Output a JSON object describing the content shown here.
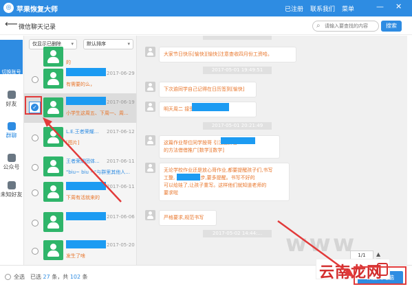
{
  "app": {
    "title": "苹果恢复大师"
  },
  "titlebar": {
    "registered": "已注册",
    "contact": "联系我们",
    "menu": "菜单",
    "minimize": "—",
    "close": "✕"
  },
  "subbar": {
    "back_glyph": "⟵",
    "title": "微信聊天记录",
    "search_placeholder": "请输入要查找的内容",
    "search_button": "搜索"
  },
  "sidebar": {
    "switch_label": "切换账号",
    "items": [
      {
        "label": "好友"
      },
      {
        "label": "群聊"
      },
      {
        "label": "公众号"
      },
      {
        "label": "未知好友"
      }
    ]
  },
  "filters": {
    "show_deleted": "仅显示已删除",
    "sort": "默认排序"
  },
  "contacts": [
    {
      "name": "",
      "date": "",
      "preview": "的"
    },
    {
      "name": "",
      "date": "2017-06-29",
      "preview": "有需要的么，"
    },
    {
      "name": "",
      "date": "2017-06-19",
      "preview": "小学生这周五、下周一、周..."
    },
    {
      "name": "L.E.王者荣耀...",
      "date": "2017-06-12",
      "preview": "[图片]"
    },
    {
      "name": "王者荣耀团体...",
      "date": "2017-06-11",
      "preview": "\"biu~ biu ~\"与群里其他人..."
    },
    {
      "name": "",
      "date": "2017-06-11",
      "preview": "下周有活就来的"
    },
    {
      "name": "",
      "date": "2017-06-06",
      "preview": ""
    },
    {
      "name": "",
      "date": "2017-05-20",
      "preview": "发生了啥"
    }
  ],
  "chat": {
    "messages": [
      {
        "text": "大家节日快乐[愉快][愉快]注意查收四月份工资哈。"
      },
      {
        "time": "2017-05-01 19:49:51"
      },
      {
        "text": "下次逾同学自己记得在日历签到[愉快]"
      },
      {
        "text": "明天周二                  接受伤暂不能来"
      },
      {
        "time": "2017-05-01 20:21:49"
      },
      {
        "lines": [
          "这篇作业帮位同学按哥                       引注上拼音",
          "的方法借借推广[数学][数学]"
        ]
      },
      {
        "lines": [
          "无论学校作业还是放心哥作业,都要提醒孩子们,书写",
          "工整,        最近书写进步,要多提醒。书写不好的",
          "可以给娃了,让孩子重写。这样他们就知道老师的",
          "要求啦"
        ]
      },
      {
        "text": "严格要求,规范书写"
      },
      {
        "time": "2017-05-02 14:44:..."
      }
    ],
    "page": "1/1"
  },
  "footer": {
    "select_all": "全选",
    "selected_prefix": "已选",
    "selected_count": "27",
    "mid": "条，共",
    "total": "102",
    "suffix": "条",
    "recover": "恢复到电脑"
  },
  "watermark": "www",
  "brand": "云南龙网",
  "colors": {
    "accent": "#2e8ce2",
    "avatar_green": "#2fb56a",
    "preview_orange": "#e8752a",
    "highlight_red": "#e23a3a"
  }
}
